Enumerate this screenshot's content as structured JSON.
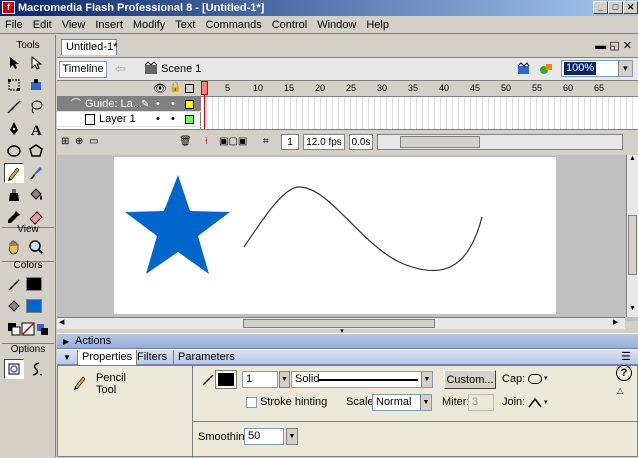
{
  "window": {
    "title": "Macromedia Flash Professional 8 - [Untitled-1*]",
    "minimize": "_",
    "maximize": "□",
    "close": "✕"
  },
  "menu": [
    "File",
    "Edit",
    "View",
    "Insert",
    "Modify",
    "Text",
    "Commands",
    "Control",
    "Window",
    "Help"
  ],
  "tools": {
    "label": "Tools",
    "view_label": "View",
    "colors_label": "Colors",
    "options_label": "Options"
  },
  "document": {
    "tab": "Untitled-1*",
    "scene": "Scene 1",
    "zoom": "100%"
  },
  "timeline": {
    "button": "Timeline",
    "ruler": [
      "1",
      "5",
      "10",
      "15",
      "20",
      "25",
      "30",
      "35",
      "40",
      "45",
      "50",
      "55",
      "60",
      "65"
    ],
    "layers": [
      {
        "name": "Guide: La..."
      },
      {
        "name": "Layer 1"
      }
    ],
    "layer_colors": [
      "#ffff00",
      "#66ff66"
    ],
    "current_frame": "1",
    "fps": "12.0 fps",
    "time": "0.0s"
  },
  "stage": {
    "star_color": "#0066cc",
    "curve_color": "#333333"
  },
  "panels": {
    "actions": "Actions",
    "tabs": [
      "Properties",
      "Filters",
      "Parameters"
    ]
  },
  "properties": {
    "tool_name_line1": "Pencil",
    "tool_name_line2": "Tool",
    "stroke_width": "1",
    "stroke_style": "Solid",
    "custom_button": "Custom...",
    "cap_label": "Cap:",
    "stroke_hinting": "Stroke hinting",
    "scale_label": "Scale:",
    "scale_value": "Normal",
    "miter_label": "Miter:",
    "miter_value": "3",
    "join_label": "Join:",
    "smoothing_label": "Smoothing",
    "smoothing_value": "50"
  }
}
